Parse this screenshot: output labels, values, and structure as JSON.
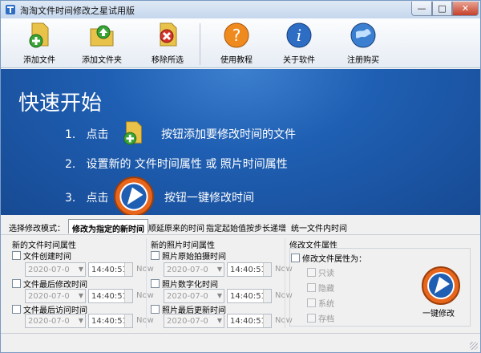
{
  "window": {
    "title": "淘淘文件时间修改之星试用版",
    "controls": {
      "minimize": "—",
      "maximize": "□",
      "close": "✕"
    }
  },
  "toolbar": {
    "add_file": "添加文件",
    "add_folder": "添加文件夹",
    "remove_selected": "移除所选",
    "tutorial": "使用教程",
    "about": "关于软件",
    "register": "注册购买"
  },
  "banner": {
    "title": "快速开始",
    "step1": {
      "num": "1.",
      "pre": "点击",
      "post": "按钮添加要修改时间的文件"
    },
    "step2": {
      "num": "2.",
      "text": "设置新的 文件时间属性 或 照片时间属性"
    },
    "step3": {
      "num": "3.",
      "pre": "点击",
      "post": "按钮一键修改时间"
    }
  },
  "mode": {
    "label": "选择修改模式：",
    "tabs": [
      "修改为指定的新时间",
      "顺延原来的时间",
      "指定起始值按步长递增",
      "统一文件内时间"
    ],
    "active": "修改为指定的新时间"
  },
  "file_time": {
    "title": "新的文件时间属性",
    "items": [
      {
        "label": "文件创建时间",
        "date": "2020-07-0",
        "time": "14:40:51",
        "now": "Now"
      },
      {
        "label": "文件最后修改时间",
        "date": "2020-07-0",
        "time": "14:40:51",
        "now": "Now"
      },
      {
        "label": "文件最后访问时间",
        "date": "2020-07-0",
        "time": "14:40:51",
        "now": "Now"
      }
    ]
  },
  "photo_time": {
    "title": "新的照片时间属性",
    "items": [
      {
        "label": "照片原始拍摄时间",
        "date": "2020-07-0",
        "time": "14:40:51",
        "now": "Now"
      },
      {
        "label": "照片数字化时间",
        "date": "2020-07-0",
        "time": "14:40:51",
        "now": "Now"
      },
      {
        "label": "照片最后更新时间",
        "date": "2020-07-0",
        "time": "14:40:51",
        "now": "Now"
      }
    ]
  },
  "attributes": {
    "title": "修改文件属性",
    "toggle": "修改文件属性为：",
    "options": [
      "只读",
      "隐藏",
      "系统",
      "存档"
    ]
  },
  "one_key": {
    "label": "一键修改"
  },
  "colors": {
    "banner": "#1f5fb3",
    "accent_orange": "#e8651c",
    "accent_blue": "#1f5fb3"
  }
}
